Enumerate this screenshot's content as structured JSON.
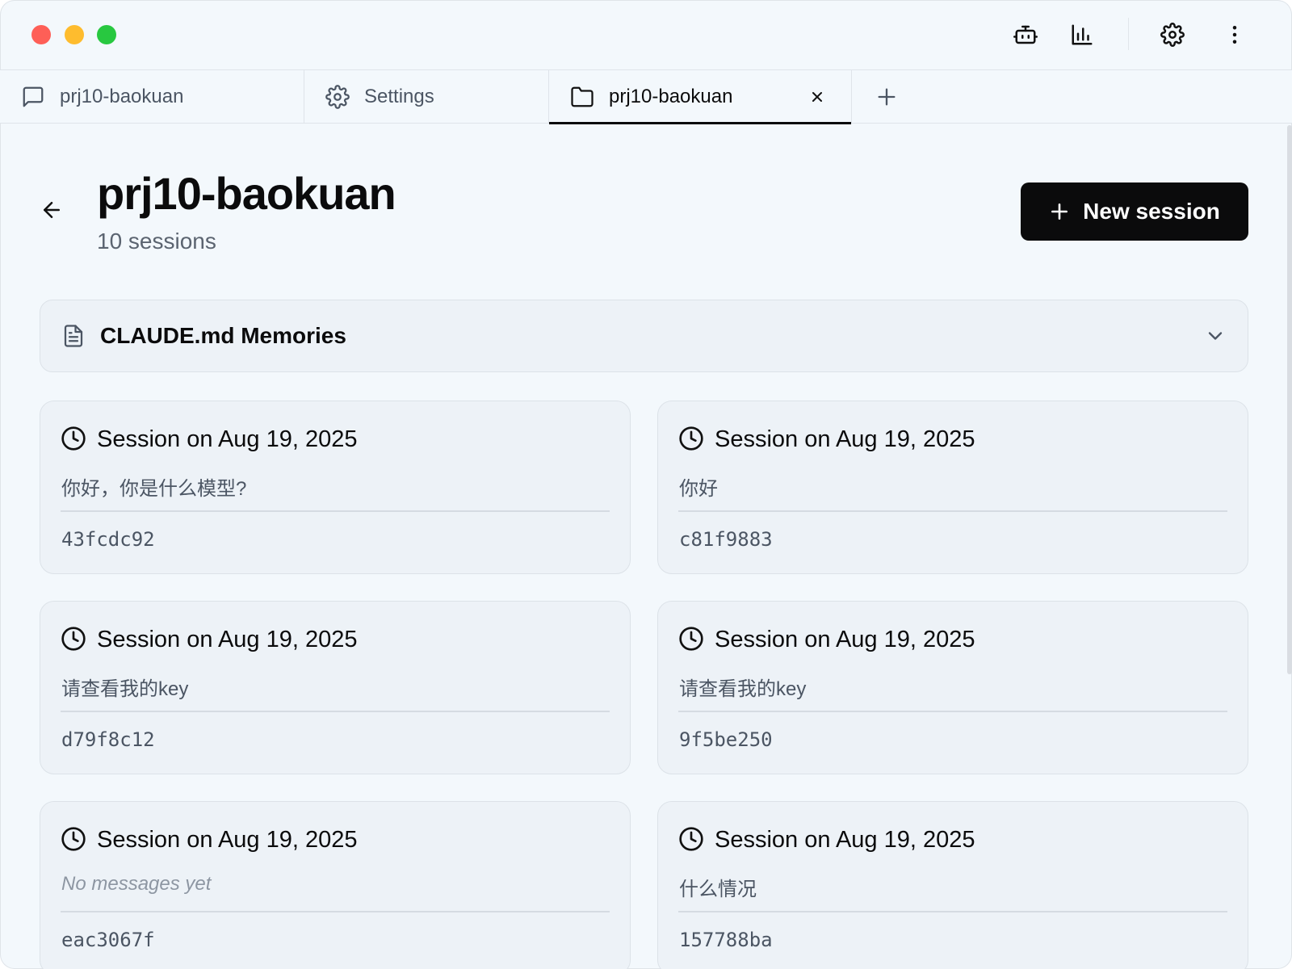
{
  "titlebar": {
    "icons": [
      "robot-icon",
      "bar-chart-icon",
      "gear-icon",
      "more-vertical-icon"
    ]
  },
  "tabs": [
    {
      "label": "prj10-baokuan",
      "icon": "message-square-icon",
      "active": false
    },
    {
      "label": "Settings",
      "icon": "gear-icon",
      "active": false
    },
    {
      "label": "prj10-baokuan",
      "icon": "folder-icon",
      "active": true,
      "closable": true
    }
  ],
  "header": {
    "title": "prj10-baokuan",
    "subtitle": "10 sessions",
    "new_session_label": "New session"
  },
  "memories": {
    "label": "CLAUDE.md Memories"
  },
  "sessions": [
    {
      "title": "Session on Aug 19, 2025",
      "message": "你好，你是什么模型?",
      "id": "43fcdc92"
    },
    {
      "title": "Session on Aug 19, 2025",
      "message": "你好",
      "id": "c81f9883"
    },
    {
      "title": "Session on Aug 19, 2025",
      "message": "请查看我的key",
      "id": "d79f8c12"
    },
    {
      "title": "Session on Aug 19, 2025",
      "message": "请查看我的key",
      "id": "9f5be250"
    },
    {
      "title": "Session on Aug 19, 2025",
      "message": "No messages yet",
      "id": "eac3067f",
      "empty": true
    },
    {
      "title": "Session on Aug 19, 2025",
      "message": "什么情况",
      "id": "157788ba"
    }
  ]
}
